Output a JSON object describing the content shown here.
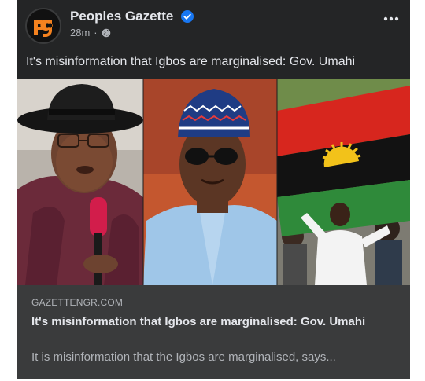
{
  "post": {
    "page_name": "Peoples Gazette",
    "timestamp": "28m",
    "separator": "·",
    "text": "It's misinformation that Igbos are marginalised: Gov. Umahi",
    "avatar_label": "pg"
  },
  "link_preview": {
    "domain": "GAZETTENGR.COM",
    "title": "It's misinformation that Igbos are marginalised: Gov. Umahi",
    "description": "It is misinformation that the Igbos are marginalised, says..."
  },
  "colors": {
    "card_bg": "#242526",
    "link_bg": "#3a3b3c",
    "verified_blue": "#1877f2",
    "logo_orange": "#f5821f"
  },
  "icons": {
    "verified": "verified-badge-icon",
    "globe": "globe-icon",
    "more": "more-options-icon"
  }
}
